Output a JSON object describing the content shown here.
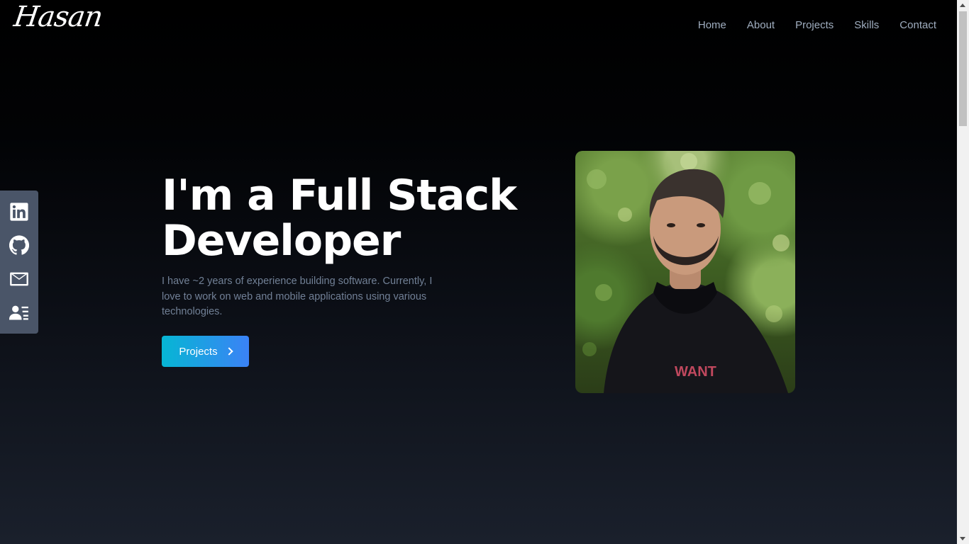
{
  "header": {
    "logo_text": "Hasan",
    "nav": [
      "Home",
      "About",
      "Projects",
      "Skills",
      "Contact"
    ]
  },
  "social": [
    {
      "icon": "linkedin-icon"
    },
    {
      "icon": "github-icon"
    },
    {
      "icon": "mail-icon"
    },
    {
      "icon": "contact-card-icon"
    }
  ],
  "hero": {
    "title": "I'm a Full Stack Developer",
    "description": "I have ~2 years of experience building software. Currently, I love to work on web and mobile applications using various technologies.",
    "cta_label": "Projects",
    "cta_icon": "chevron-right-icon"
  },
  "colors": {
    "nav_text": "#a0aec0",
    "description_text": "#718096",
    "sidebar_bg": "#4a5568",
    "cta_gradient_start": "#06b6d4",
    "cta_gradient_end": "#3b82f6"
  }
}
